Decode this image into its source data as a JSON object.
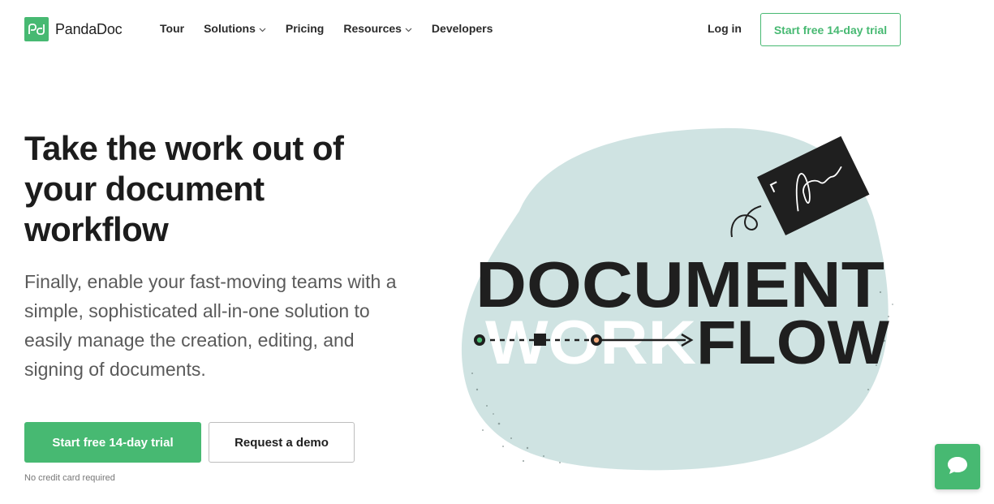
{
  "brand": {
    "name": "PandaDoc",
    "accent": "#47b972",
    "illustration_bg": "#cfe3e2"
  },
  "nav": {
    "items": [
      {
        "label": "Tour",
        "has_dropdown": false
      },
      {
        "label": "Solutions",
        "has_dropdown": true
      },
      {
        "label": "Pricing",
        "has_dropdown": false
      },
      {
        "label": "Resources",
        "has_dropdown": true
      },
      {
        "label": "Developers",
        "has_dropdown": false
      }
    ],
    "login_label": "Log in",
    "trial_label": "Start free 14-day trial"
  },
  "hero": {
    "title": "Take the work out of your document workflow",
    "subtitle": "Finally, enable your fast-moving teams with a simple, sophisticated all-in-one solution to easily manage the creation, editing, and signing of documents.",
    "primary_cta": "Start free 14-day trial",
    "secondary_cta": "Request a demo",
    "note": "No credit card required"
  },
  "illustration": {
    "line1": "DOCUMENT",
    "line2_ghost": "WORK",
    "line2": "FLOW"
  },
  "chat": {
    "icon": "chat-bubble-icon"
  }
}
